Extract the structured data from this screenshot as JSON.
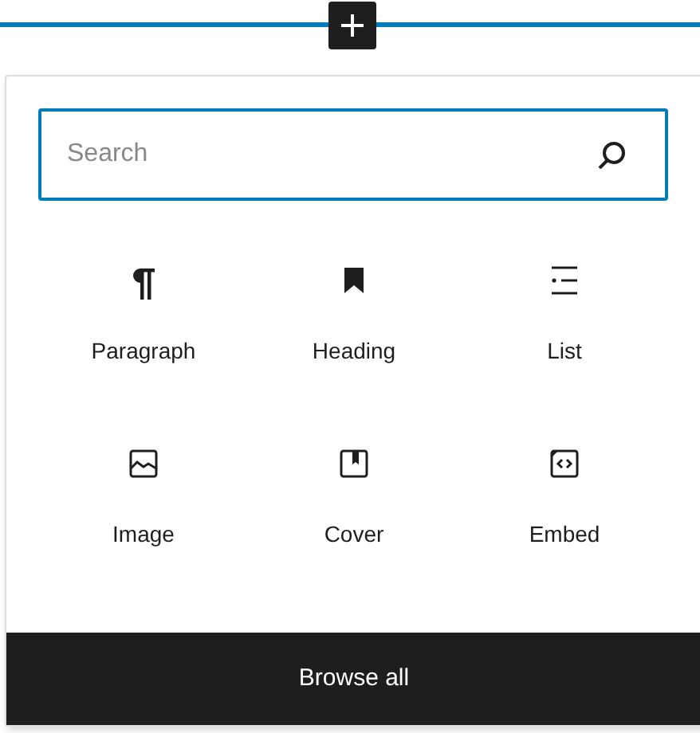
{
  "inserter": {
    "search": {
      "placeholder": "Search"
    },
    "blocks": [
      {
        "kind": "paragraph",
        "label": "Paragraph"
      },
      {
        "kind": "heading",
        "label": "Heading"
      },
      {
        "kind": "list",
        "label": "List"
      },
      {
        "kind": "image",
        "label": "Image"
      },
      {
        "kind": "cover",
        "label": "Cover"
      },
      {
        "kind": "embed",
        "label": "Embed"
      }
    ],
    "browse_all": "Browse all"
  }
}
